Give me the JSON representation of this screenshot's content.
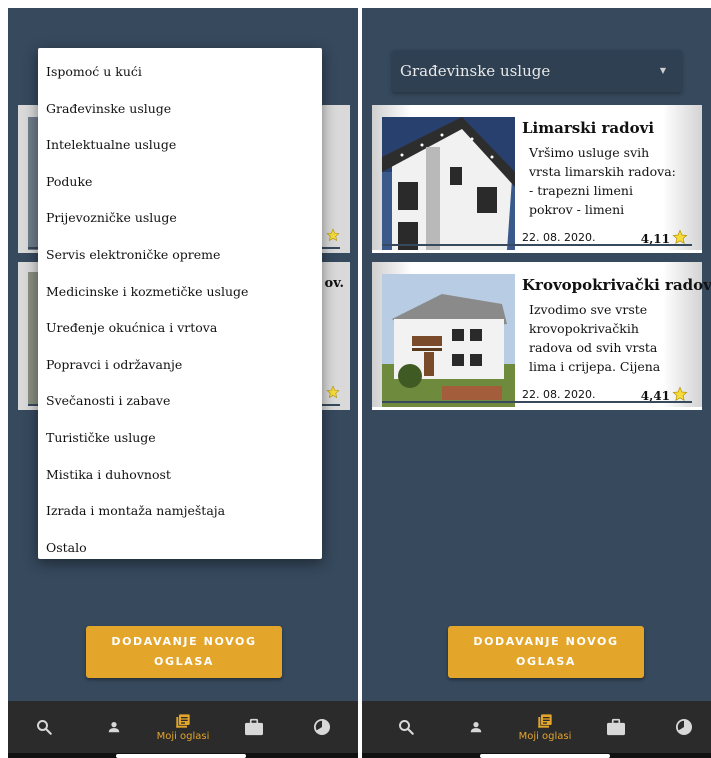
{
  "menu": {
    "items": [
      "Ispomoć u kući",
      "Građevinske usluge",
      "Intelektualne usluge",
      "Poduke",
      "Prijevozničke usluge",
      "Servis elektroničke opreme",
      "Medicinske i kozmetičke usluge",
      "Uređenje okućnica i vrtova",
      "Popravci i održavanje",
      "Svečanosti i zabave",
      "Turističke usluge",
      "Mistika i duhovnost",
      "Izrada i montaža namještaja",
      "Ostalo"
    ]
  },
  "left": {
    "bg_title_fragment": "ov.",
    "star_1": "☆",
    "star_2": "☆"
  },
  "select": {
    "value": "Građevinske usluge"
  },
  "listings": [
    {
      "title": "Limarski radovi",
      "description": "Vršimo usluge svih vrsta limarskih radova: - trapezni limeni pokrov - limeni",
      "date": "22. 08. 2020.",
      "rating": "4,11"
    },
    {
      "title": "Krovopokrivački radov",
      "description": "Izvodimo sve vrste krovopokrivačkih radova od svih vrsta lima i crijepa.   Cijena",
      "date": "22. 08. 2020.",
      "rating": "4,41"
    }
  ],
  "add_button": {
    "line1": "DODAVANJE NOVOG",
    "line2": "OGLASA"
  },
  "nav": {
    "items": [
      {
        "icon": "search-icon"
      },
      {
        "icon": "person-icon"
      },
      {
        "icon": "my-ads-icon",
        "label": "Moji oglasi"
      },
      {
        "icon": "briefcase-icon"
      },
      {
        "icon": "pie-chart-icon"
      }
    ]
  },
  "colors": {
    "background": "#36495d",
    "accent": "#e4a52b",
    "nav": "#2b2b2b"
  }
}
